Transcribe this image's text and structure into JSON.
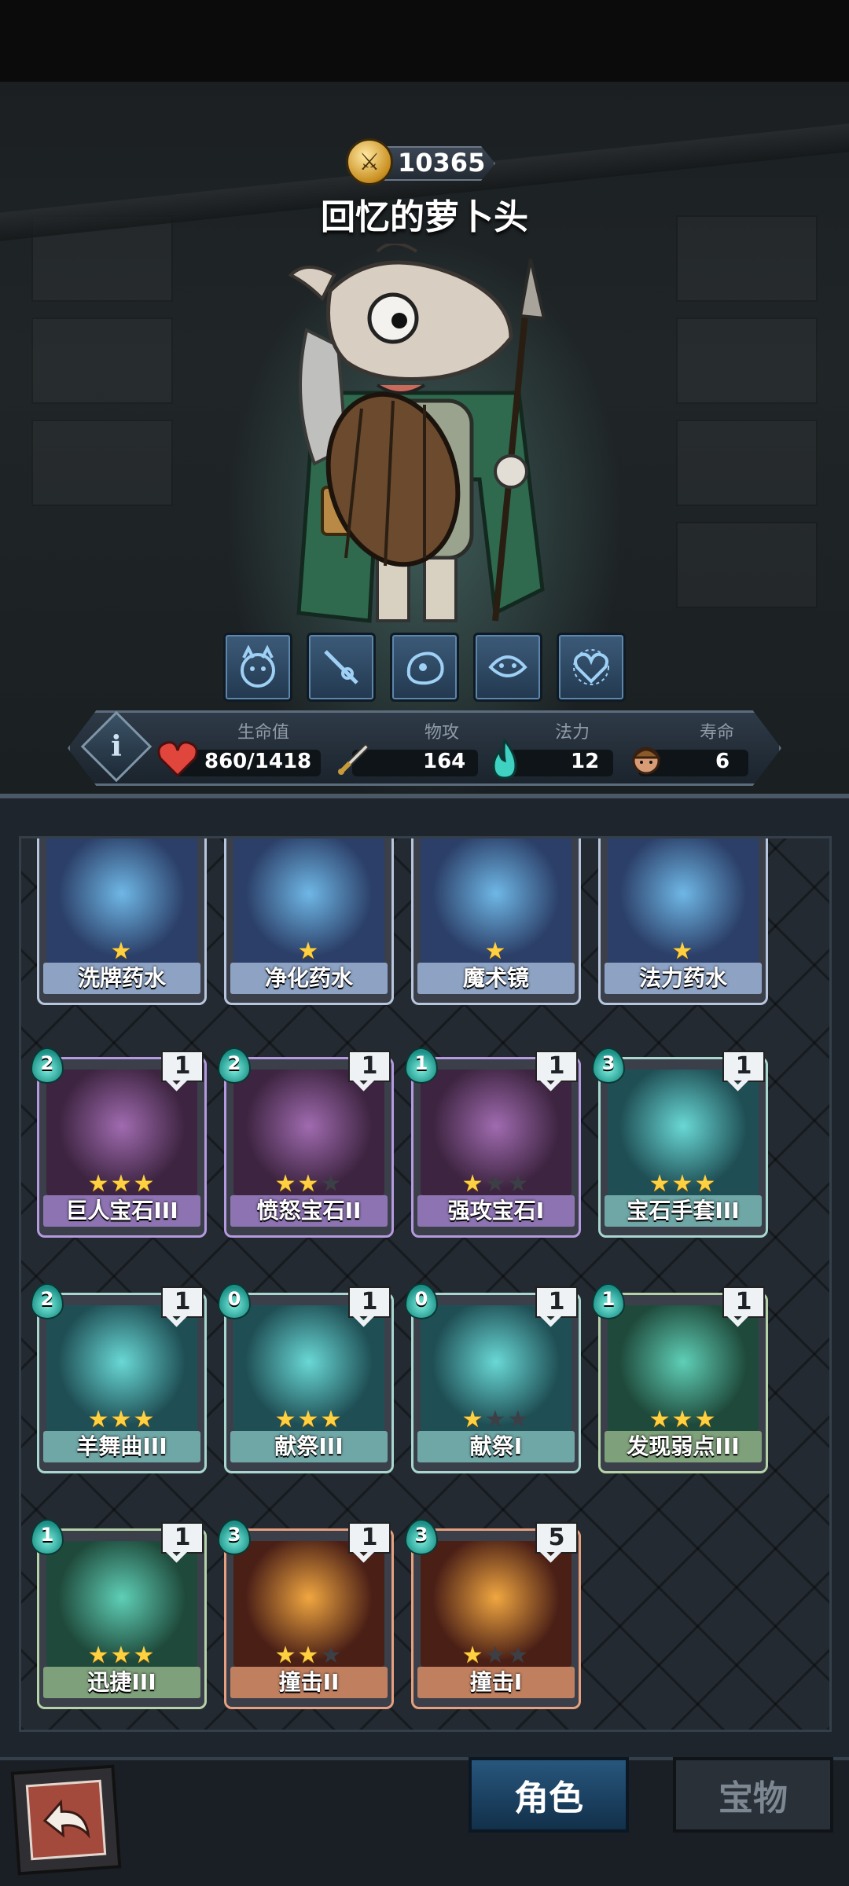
{
  "header": {
    "gold_amount": "10365",
    "character_name": "回忆的萝卜头"
  },
  "abilities": [
    {
      "icon": "monster-face-icon"
    },
    {
      "icon": "wand-icon"
    },
    {
      "icon": "stone-icon"
    },
    {
      "icon": "dragon-face-icon"
    },
    {
      "icon": "heart-rune-icon"
    }
  ],
  "stats": {
    "hp_label": "生命值",
    "hp_value": "860/1418",
    "attack_label": "物攻",
    "attack_value": "164",
    "mana_label": "法力",
    "mana_value": "12",
    "life_label": "寿命",
    "life_value": "6"
  },
  "cards": [
    {
      "name": "洗牌药水",
      "color": "blue",
      "stars": 1,
      "cost": "",
      "count": ""
    },
    {
      "name": "净化药水",
      "color": "blue",
      "stars": 1,
      "cost": "",
      "count": ""
    },
    {
      "name": "魔术镜",
      "color": "blue",
      "stars": 1,
      "cost": "",
      "count": ""
    },
    {
      "name": "法力药水",
      "color": "blue",
      "stars": 1,
      "cost": "",
      "count": ""
    },
    {
      "name": "巨人宝石III",
      "color": "purple",
      "stars": 3,
      "cost": "2",
      "count": "1"
    },
    {
      "name": "愤怒宝石II",
      "color": "purple",
      "stars": 2,
      "cost": "2",
      "count": "1"
    },
    {
      "name": "强攻宝石I",
      "color": "purple",
      "stars": 1,
      "cost": "1",
      "count": "1"
    },
    {
      "name": "宝石手套III",
      "color": "teal",
      "stars": 3,
      "cost": "3",
      "count": "1"
    },
    {
      "name": "羊舞曲III",
      "color": "teal",
      "stars": 3,
      "cost": "2",
      "count": "1"
    },
    {
      "name": "献祭III",
      "color": "teal",
      "stars": 3,
      "cost": "0",
      "count": "1"
    },
    {
      "name": "献祭I",
      "color": "teal",
      "stars": 1,
      "cost": "0",
      "count": "1"
    },
    {
      "name": "发现弱点III",
      "color": "green",
      "stars": 3,
      "cost": "1",
      "count": "1"
    },
    {
      "name": "迅捷III",
      "color": "green",
      "stars": 3,
      "cost": "1",
      "count": "1"
    },
    {
      "name": "撞击II",
      "color": "red",
      "stars": 2,
      "cost": "3",
      "count": "1"
    },
    {
      "name": "撞击I",
      "color": "red",
      "stars": 1,
      "cost": "3",
      "count": "5"
    }
  ],
  "tabs": {
    "active": "角色",
    "inactive": "宝物"
  },
  "colors": {
    "accent_gold": "#ffd040",
    "mana_teal": "#1b8f86",
    "hp_red": "#e0463c"
  }
}
